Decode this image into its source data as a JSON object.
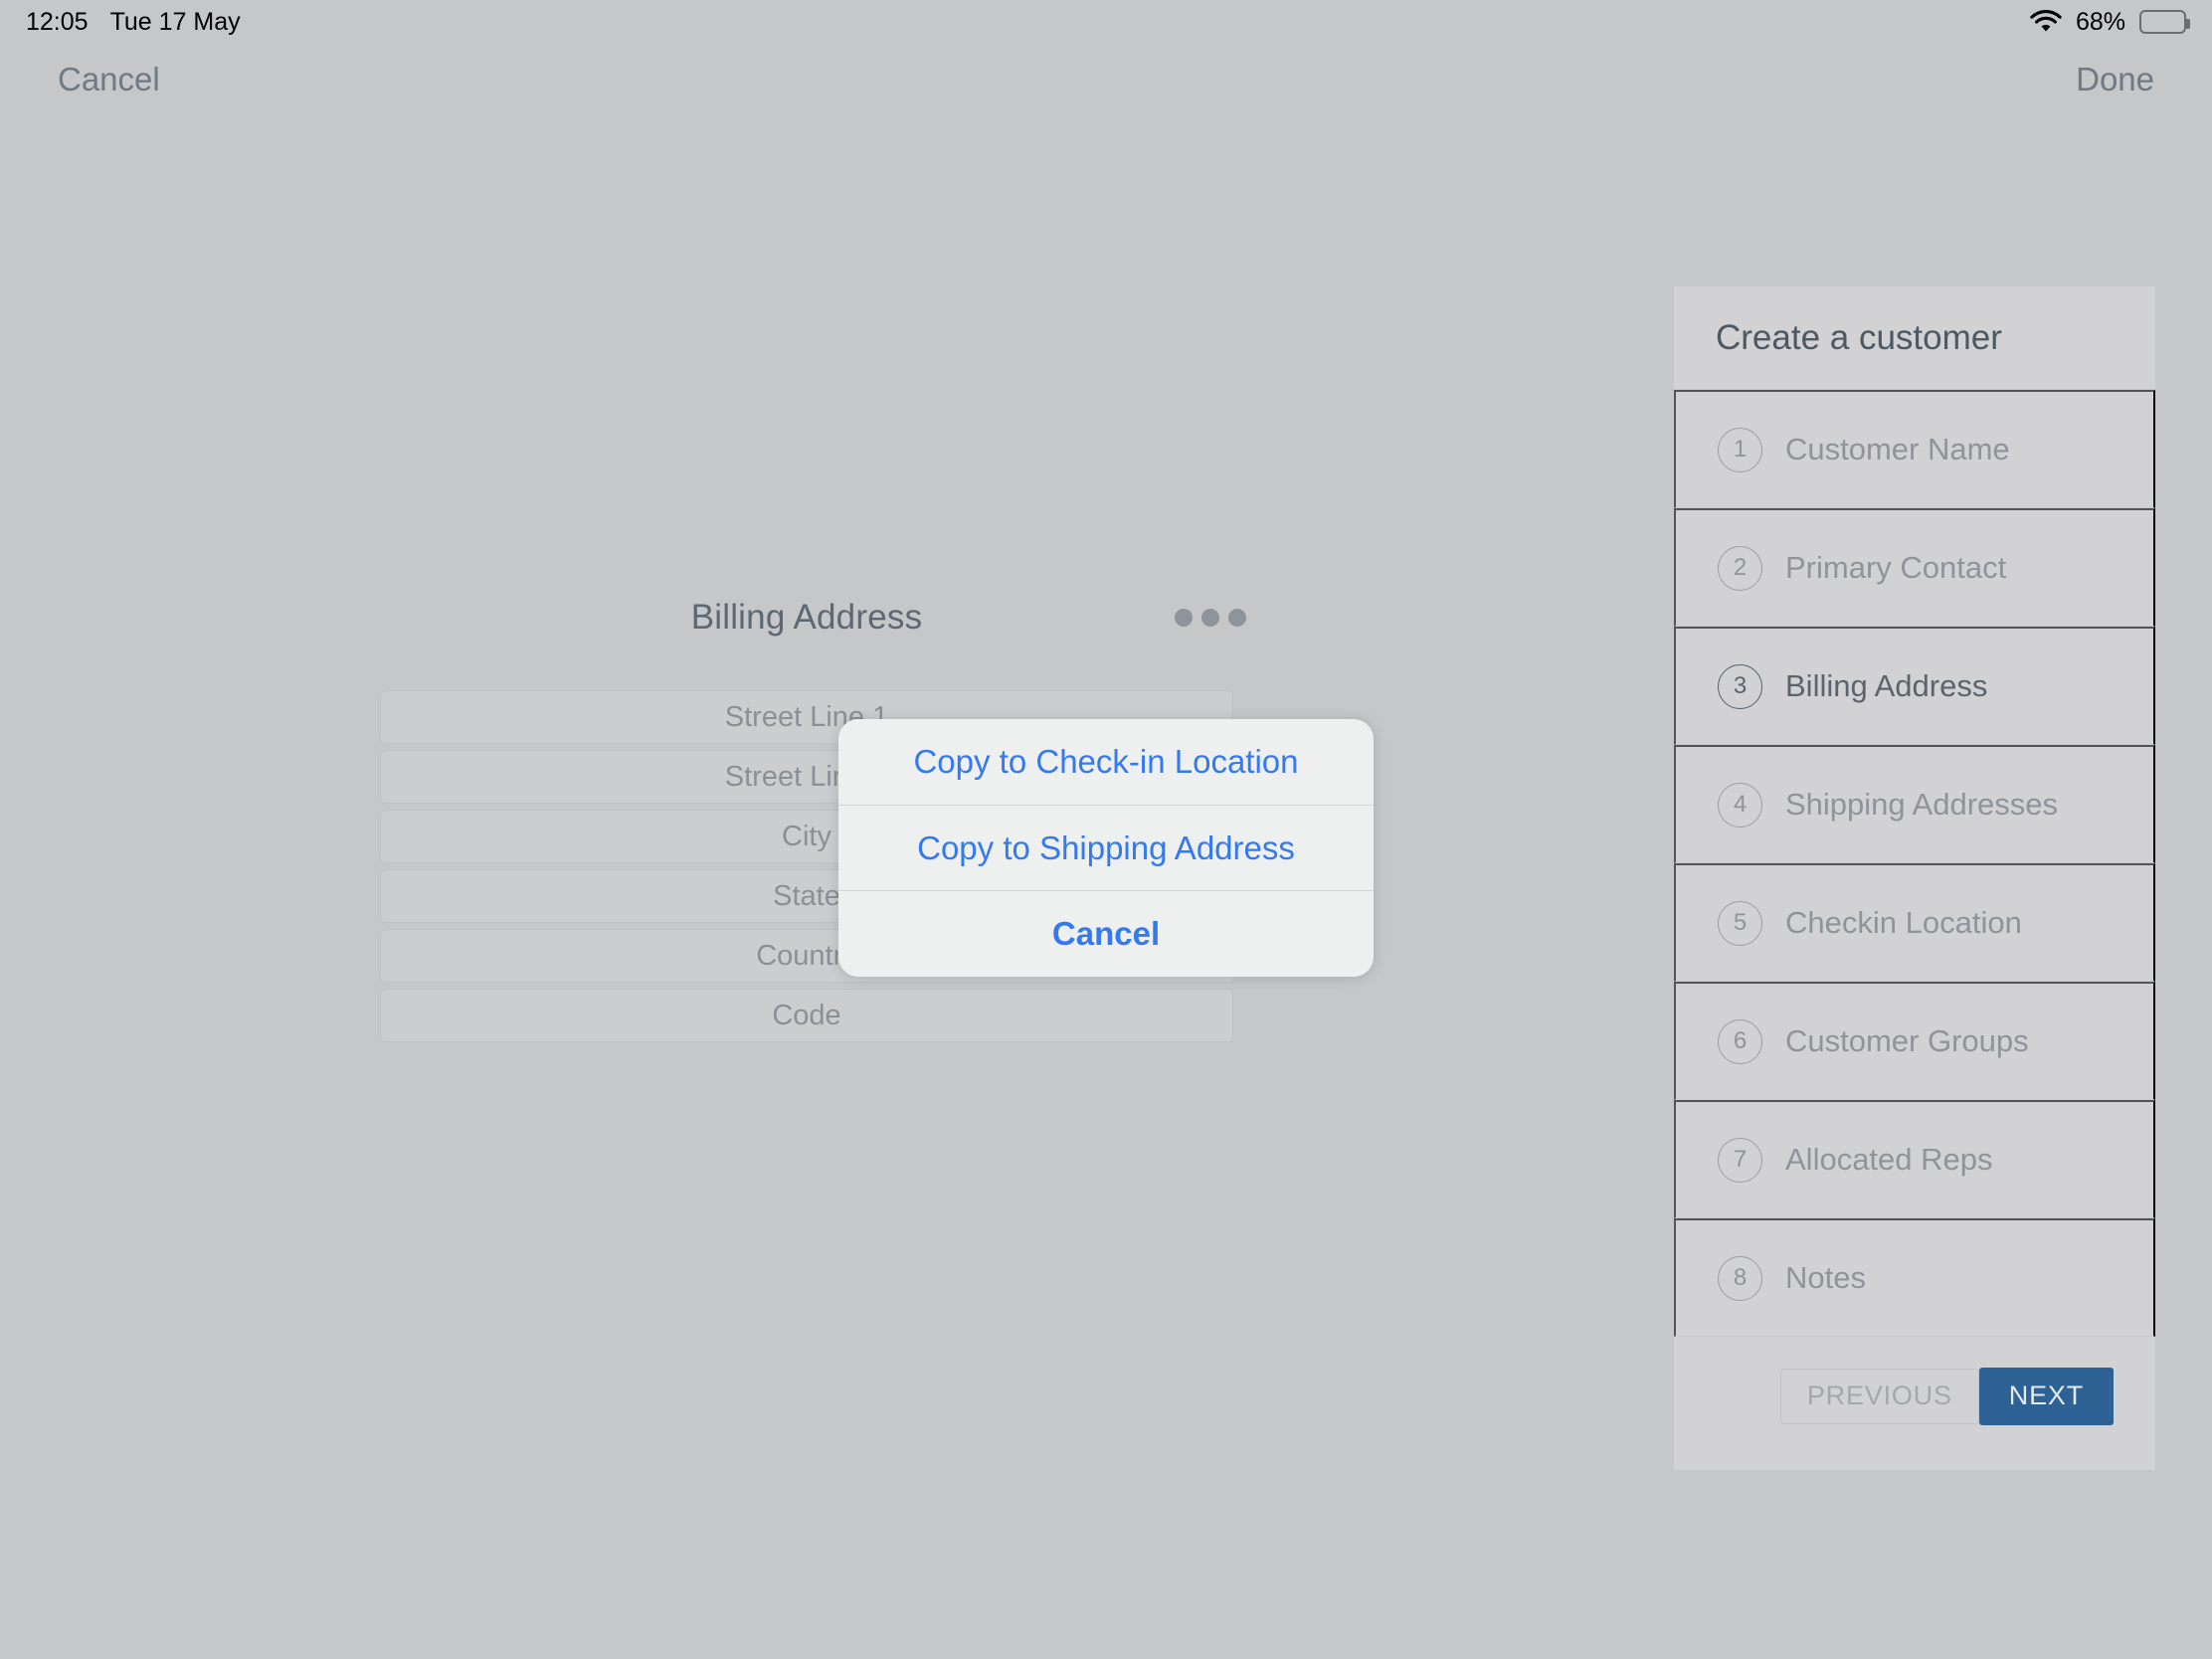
{
  "status_bar": {
    "time": "12:05",
    "date": "Tue 17 May",
    "battery_percent": "68%",
    "battery_level": 68,
    "wifi_icon": "wifi-icon",
    "battery_icon": "battery-icon"
  },
  "nav": {
    "cancel_label": "Cancel",
    "done_label": "Done"
  },
  "form": {
    "title": "Billing Address",
    "more_icon": "more-options-icon",
    "fields": [
      {
        "placeholder": "Street Line 1"
      },
      {
        "placeholder": "Street Line 2"
      },
      {
        "placeholder": "City"
      },
      {
        "placeholder": "State"
      },
      {
        "placeholder": "Country"
      },
      {
        "placeholder": "Code"
      }
    ]
  },
  "action_sheet": {
    "items": [
      {
        "label": "Copy to Check-in Location"
      },
      {
        "label": "Copy to Shipping Address"
      },
      {
        "label": "Cancel"
      }
    ]
  },
  "sidebar": {
    "title": "Create a customer",
    "steps": [
      {
        "number": "1",
        "label": "Customer Name",
        "active": false
      },
      {
        "number": "2",
        "label": "Primary Contact",
        "active": false
      },
      {
        "number": "3",
        "label": "Billing Address",
        "active": true
      },
      {
        "number": "4",
        "label": "Shipping Addresses",
        "active": false
      },
      {
        "number": "5",
        "label": "Checkin Location",
        "active": false
      },
      {
        "number": "6",
        "label": "Customer Groups",
        "active": false
      },
      {
        "number": "7",
        "label": "Allocated Reps",
        "active": false
      },
      {
        "number": "8",
        "label": "Notes",
        "active": false
      }
    ],
    "previous_label": "PREVIOUS",
    "next_label": "NEXT"
  },
  "colors": {
    "page_bg": "#c6c7c9",
    "panel_bg": "#d2d2d4",
    "accent_blue": "#2e6194",
    "link_blue": "#3479ef",
    "muted_text": "#8e949a",
    "active_text": "#5b646d"
  }
}
